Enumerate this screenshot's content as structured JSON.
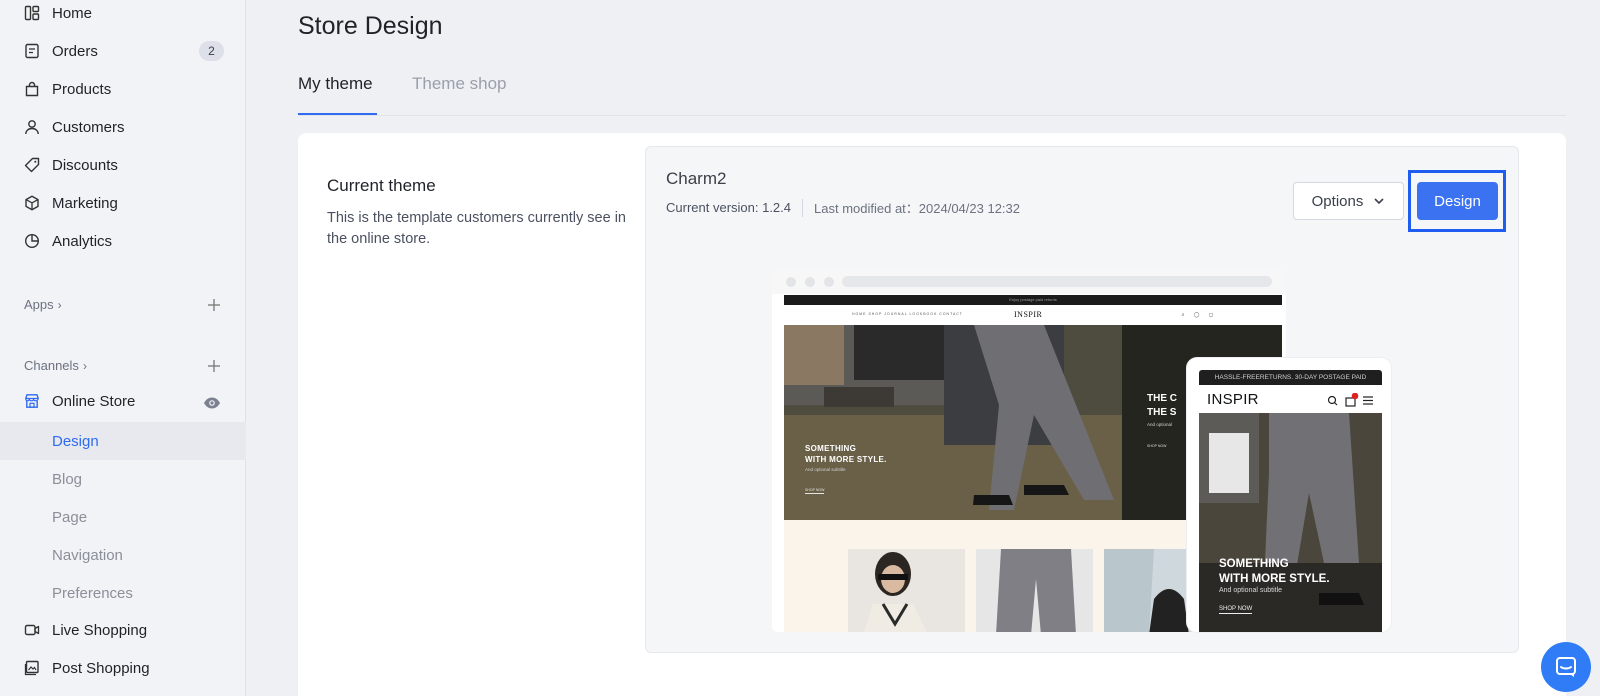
{
  "sidebar": {
    "items": [
      {
        "label": "Home",
        "icon": "home-icon"
      },
      {
        "label": "Orders",
        "icon": "orders-icon",
        "badge": "2"
      },
      {
        "label": "Products",
        "icon": "bag-icon"
      },
      {
        "label": "Customers",
        "icon": "person-icon"
      },
      {
        "label": "Discounts",
        "icon": "tag-icon"
      },
      {
        "label": "Marketing",
        "icon": "cube-icon"
      },
      {
        "label": "Analytics",
        "icon": "pie-chart-icon"
      }
    ],
    "apps_label": "Apps",
    "channels_label": "Channels",
    "online_store": {
      "label": "Online Store",
      "icon": "store-icon"
    },
    "sub_items": [
      "Design",
      "Blog",
      "Page",
      "Navigation",
      "Preferences"
    ],
    "live_shopping": {
      "label": "Live Shopping",
      "icon": "video-icon"
    },
    "post_shopping": {
      "label": "Post Shopping",
      "icon": "post-icon"
    }
  },
  "page": {
    "title": "Store Design",
    "tabs": [
      {
        "label": "My theme",
        "active": true
      },
      {
        "label": "Theme shop",
        "active": false
      }
    ]
  },
  "current_theme": {
    "heading": "Current theme",
    "description": "This is the template customers currently see in the online store.",
    "name": "Charm2",
    "version": "Current version: 1.2.4",
    "modified": "Last modified at：2024/04/23 12:32",
    "options_label": "Options",
    "design_label": "Design"
  },
  "preview": {
    "announce": "Enjoy postage paid returns",
    "nav_links": "HOME SHOP JOURNAL LOOKBOOK CONTACT",
    "logo": "INSPIR",
    "hero_title_1": "SOMETHING",
    "hero_title_2": "WITH MORE STYLE.",
    "hero_sub": "And optional subtitle",
    "hero_shop": "SHOP NOW",
    "hero_right_1": "THE C",
    "hero_right_2": "THE S",
    "hero_right_sub": "And optional",
    "hero_right_shop": "SHOP NOW",
    "mobile_announce": "HASSLE-FREERETURNS. 30-DAY POSTAGE PAID",
    "mobile_logo": "INSPIR",
    "mobile_cart_count": "1",
    "mobile_title_1": "SOMETHING",
    "mobile_title_2": "WITH MORE STYLE.",
    "mobile_sub": "And optional subtitle",
    "mobile_shop": "SHOP NOW"
  },
  "colors": {
    "accent": "#2f6bf0",
    "design_button": "#3a72f2",
    "focus_outline": "#1f5cf0",
    "chat_button": "#2f7cf6"
  }
}
